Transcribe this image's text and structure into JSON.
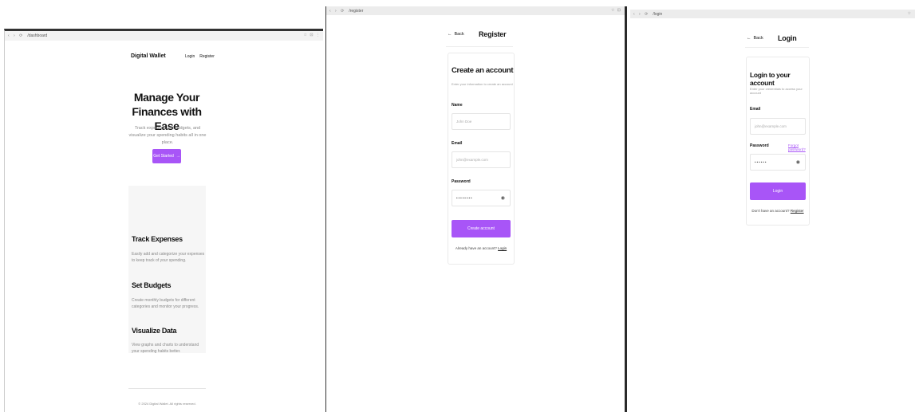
{
  "dashboard": {
    "tab": "/dashboard",
    "logo": "Digital Wallet",
    "nav": {
      "login": "Login",
      "register": "Register"
    },
    "hero": {
      "title": "Manage Your Finances with Ease",
      "subtitle": "Track expenses, set budgets, and visualize your spending habits all in one place.",
      "cta": "Get Started",
      "cta_icon": "arrow-right-icon"
    },
    "features": [
      {
        "title": "Track Expenses",
        "desc": "Easily add and categorize your expenses to keep track of your spending."
      },
      {
        "title": "Set Budgets",
        "desc": "Create monthly budgets for different categories and monitor your progress."
      },
      {
        "title": "Visualize Data",
        "desc": "View graphs and charts to understand your spending habits better."
      }
    ],
    "footer": "© 2024 Digital Wallet. All rights reserved."
  },
  "register": {
    "tab": "/register",
    "back": "Back",
    "page_title": "Register",
    "card_title": "Create an account",
    "card_sub": "Enter your information to create an account",
    "name_label": "Name",
    "name_placeholder": "John Doe",
    "email_label": "Email",
    "email_placeholder": "john@example.com",
    "password_label": "Password",
    "password_value": "••••••••",
    "submit": "Create account",
    "footer_text": "Already have an account?",
    "footer_link": "Login"
  },
  "login": {
    "tab": "/login",
    "back": "Back",
    "page_title": "Login",
    "card_title": "Login to your account",
    "card_sub": "Enter your credentials to access your account",
    "email_label": "Email",
    "email_placeholder": "john@example.com",
    "password_label": "Password",
    "forgot": "Forgot password?",
    "password_value": "••••••",
    "submit": "Login",
    "footer_text": "Don't have an account?",
    "footer_link": "Register"
  },
  "colors": {
    "accent": "#a855f7",
    "muted": "#888888",
    "panel": "#f6f6f6"
  }
}
